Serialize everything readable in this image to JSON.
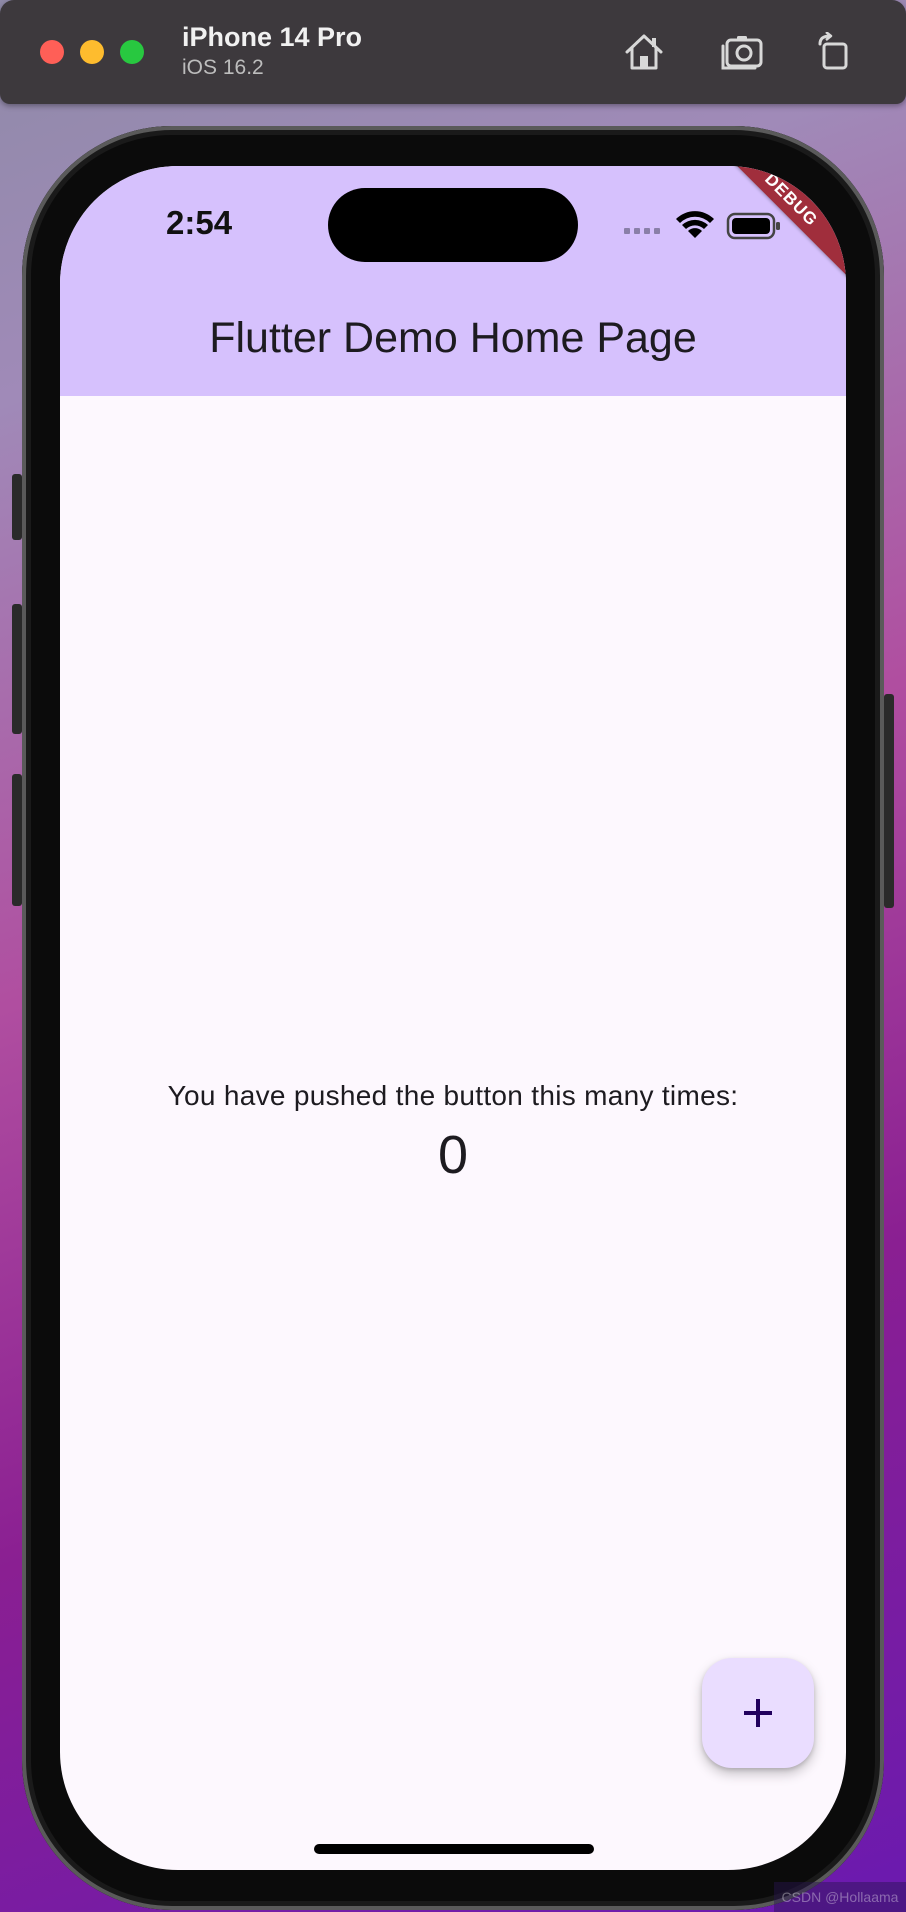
{
  "window": {
    "device_name": "iPhone 14 Pro",
    "os_version": "iOS 16.2",
    "toolbar_icons": [
      "home-icon",
      "screenshot-icon",
      "rotate-icon"
    ]
  },
  "status_bar": {
    "time": "2:54",
    "icons": [
      "cellular-signal-icon",
      "wifi-icon",
      "battery-icon"
    ]
  },
  "debug_banner": "DEBUG",
  "app_bar": {
    "title": "Flutter Demo Home Page",
    "color": "#d6c1fd"
  },
  "body": {
    "message": "You have pushed the button this many times:",
    "counter": "0",
    "background": "#fdf8fe"
  },
  "fab": {
    "icon": "plus-icon",
    "color": "#eaddff",
    "icon_color": "#21005d"
  },
  "watermark": "CSDN @Hollaama"
}
